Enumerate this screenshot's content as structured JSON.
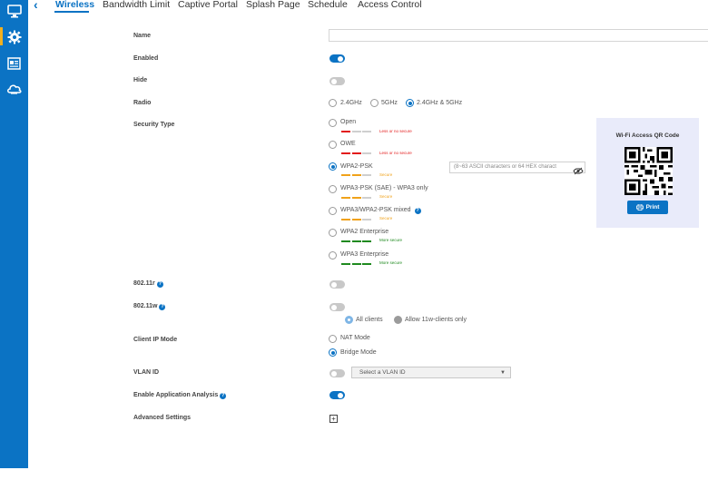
{
  "tabs": [
    {
      "label": "Wireless",
      "active": true
    },
    {
      "label": "Bandwidth Limit"
    },
    {
      "label": "Captive Portal"
    },
    {
      "label": "Splash Page"
    },
    {
      "label": "Schedule"
    },
    {
      "label": "Access Control"
    }
  ],
  "sidebar": {
    "items": [
      {
        "icon": "monitor-icon"
      },
      {
        "icon": "gear-icon",
        "active": true
      },
      {
        "icon": "report-icon"
      },
      {
        "icon": "cloud-icon"
      }
    ]
  },
  "form": {
    "name_label": "Name",
    "name_value": "",
    "enabled_label": "Enabled",
    "enabled": true,
    "hide_label": "Hide",
    "hide": false,
    "radio_label": "Radio",
    "radio_options": [
      "2.4GHz",
      "5GHz",
      "2.4GHz & 5GHz"
    ],
    "radio_selected": "2.4GHz & 5GHz",
    "security_label": "Security Type",
    "security_options": [
      {
        "label": "Open",
        "note": "Less or no secure",
        "level": 1
      },
      {
        "label": "OWE",
        "note": "Less or no secure",
        "level": 1
      },
      {
        "label": "WPA2-PSK",
        "note": "Secure",
        "level": 2,
        "selected": true
      },
      {
        "label": "WPA3-PSK (SAE) - WPA3 only",
        "note": "Secure",
        "level": 2
      },
      {
        "label": "WPA3/WPA2-PSK mixed",
        "note": "Secure",
        "level": 2
      },
      {
        "label": "WPA2 Enterprise",
        "note": "More secure",
        "level": 3
      },
      {
        "label": "WPA3 Enterprise",
        "note": "More secure",
        "level": 3
      }
    ],
    "password_placeholder": "(8~63 ASCII characters or 64 HEX charact",
    "r80211r_label": "802.11r",
    "r80211r": false,
    "w80211w_label": "802.11w",
    "w80211w": false,
    "w_all_clients": "All clients",
    "w_allow_only": "Allow 11w-clients only",
    "client_ip_label": "Client IP Mode",
    "nat_mode": "NAT Mode",
    "bridge_mode": "Bridge Mode",
    "vlan_label": "VLAN ID",
    "vlan_enabled": false,
    "vlan_placeholder": "Select a VLAN ID",
    "app_analysis_label": "Enable Application Analysis",
    "app_analysis": true,
    "advanced_label": "Advanced Settings"
  },
  "qr": {
    "title": "Wi-Fi Access QR Code",
    "print_label": "Print"
  },
  "colors": {
    "accent": "#0b73c4",
    "less_secure": "#e21b1b",
    "secure": "#f0a21a",
    "more_secure": "#1f8a1f"
  }
}
